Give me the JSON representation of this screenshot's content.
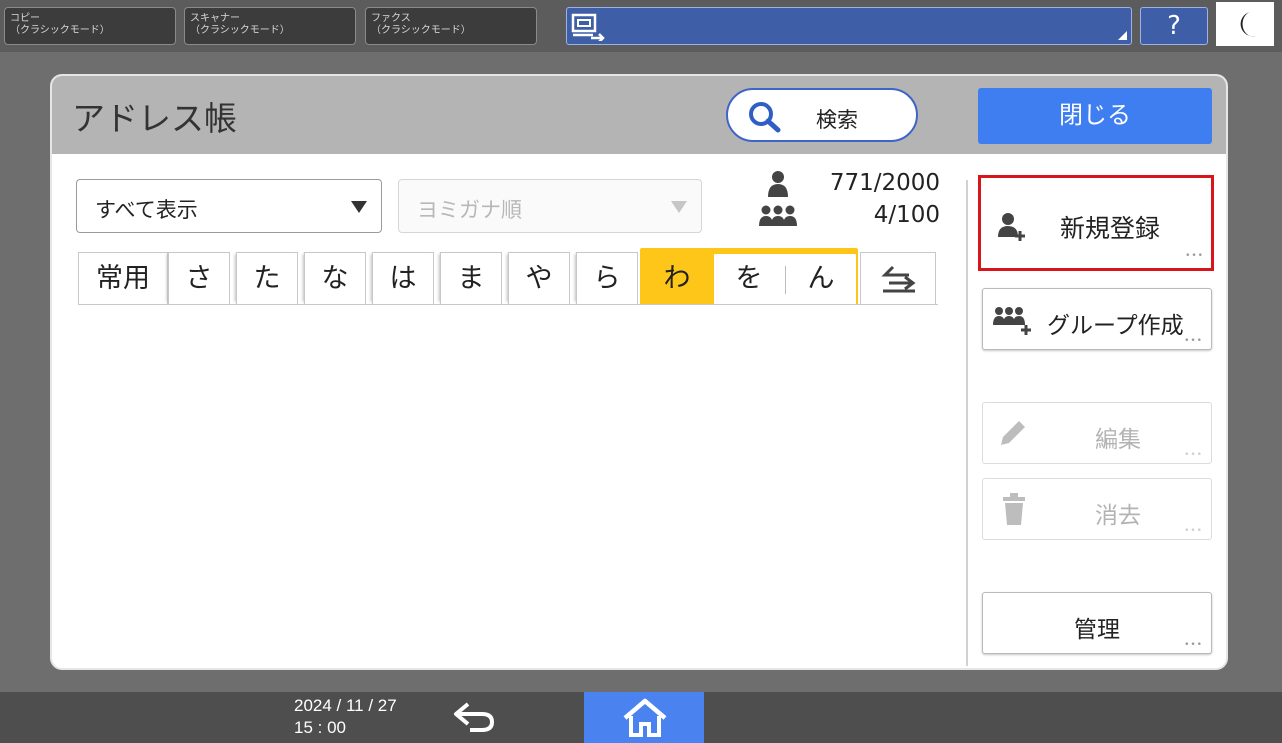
{
  "topbar": {
    "modes": [
      {
        "line1": "コピー",
        "line2": "（クラシックモード）"
      },
      {
        "line1": "スキャナー",
        "line2": "（クラシックモード）"
      },
      {
        "line1": "ファクス",
        "line2": "（クラシックモード）"
      }
    ],
    "help_label": "?"
  },
  "dialog": {
    "title": "アドレス帳",
    "search_label": "検索",
    "close_label": "閉じる",
    "filter": {
      "selected": "すべて表示"
    },
    "sort": {
      "selected": "ヨミガナ順"
    },
    "counts": {
      "users": "771/2000",
      "groups": "4/100"
    },
    "tabs": [
      "常用",
      "さ",
      "た",
      "な",
      "は",
      "ま",
      "や",
      "ら"
    ],
    "tab_wa": {
      "main": "わ",
      "sub": [
        "を",
        "ん"
      ]
    },
    "side": {
      "new_entry": "新規登録",
      "create_group": "グループ作成",
      "edit": "編集",
      "delete": "消去",
      "manage": "管理"
    }
  },
  "footer": {
    "date": "2024 / 11 / 27",
    "time": "15 : 00"
  },
  "colors": {
    "accent_blue": "#3f7ef0",
    "active_tab": "#ffc61a",
    "highlight": "#d8141c"
  }
}
